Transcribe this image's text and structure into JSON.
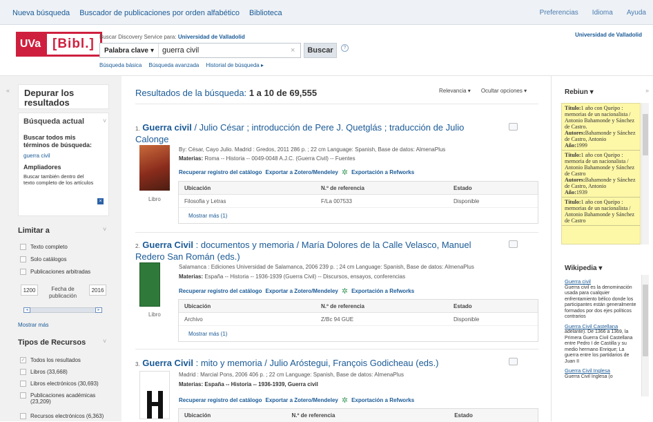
{
  "topbar": {
    "left": [
      "Nueva búsqueda",
      "Buscador de publicaciones por orden alfabético",
      "Biblioteca"
    ],
    "right": [
      "Preferencias",
      "Idioma",
      "Ayuda"
    ]
  },
  "header": {
    "logo_uva": "UVa",
    "logo_bibl": "[Bibl.]",
    "service_prefix": "Buscar Discovery Service para:",
    "service_org": "Universidad de Valladolid",
    "search_type": "Palabra clave",
    "search_value": "guerra civil",
    "search_button": "Buscar",
    "help": "?",
    "links": [
      "Búsqueda básica",
      "Búsqueda avanzada",
      "Historial de búsqueda ▸"
    ],
    "institution": "Universidad de Valladolid"
  },
  "left": {
    "refine_title": "Depurar los resultados",
    "current_search": "Búsqueda actual",
    "search_all": "Buscar todos mis términos de búsqueda:",
    "term": "guerra civil",
    "expanders": "Ampliadores",
    "expander_opt": "Buscar también dentro del texto completo de los artículos",
    "limit_to": "Limitar a",
    "limits": [
      "Texto completo",
      "Solo catálogos",
      "Publicaciones arbitradas"
    ],
    "date_from": "1200",
    "date_label": "Fecha de publicación",
    "date_to": "2016",
    "show_more": "Mostrar más",
    "resource_types": "Tipos de Recursos",
    "types": [
      "Todos los resultados",
      "Libros (33,668)",
      "Libros electrónicos (30,693)",
      "Publicaciones académicas (23,209)",
      "Recursos electrónicos (6,363)"
    ]
  },
  "main": {
    "results_label": "Resultados de la búsqueda:",
    "results_count": "1 a 10 de 69,555",
    "sort": "Relevancia ▾",
    "options": "Ocultar opciones ▾",
    "records": [
      {
        "num": "1.",
        "title_bold": "Guerra civil",
        "title_rest": " / Julio César ; introducción de Pere J. Quetglás ; traducción de Julio Calonge",
        "byline": "By: César, Cayo Julio. Madrid : Gredos, 2011 286 p. ; 22 cm Language: Spanish, Base de datos: AlmenaPlus",
        "subjects_label": "Materias:",
        "subjects": " Roma -- Historia -- 0049-0048 A.J.C. (Guerra Civil) -- Fuentes",
        "type": "Libro",
        "rows": [
          [
            "Filosofia y Letras",
            "F/La 007533",
            "Disponible"
          ]
        ]
      },
      {
        "num": "2.",
        "title_bold": "Guerra Civil",
        "title_rest": " : documentos y memoria / María Dolores de la Calle Velasco, Manuel Redero San Román (eds.)",
        "byline": "Salamanca : Ediciones Universidad de Salamanca, 2006 239 p. ; 24 cm Language: Spanish, Base de datos: AlmenaPlus",
        "subjects_label": "Materias:",
        "subjects": " España -- Historia -- 1936-1939 (Guerra Civil) -- Discursos, ensayos, conferencias",
        "type": "Libro",
        "rows": [
          [
            "Archivo",
            "Z/Bc 94 GUE",
            "Disponible"
          ]
        ]
      },
      {
        "num": "3.",
        "title_bold": "Guerra Civil",
        "title_rest": " : mito y memoria / Julio Aróstegui, François Godicheau (eds.)",
        "byline": "Madrid : Marcial Pons, 2006 406 p. ; 22 cm Language: Spanish, Base de datos: AlmenaPlus",
        "subjects_label": "Materias:",
        "subjects": " España -- Historia -- 1936-1939, Guerra civil",
        "type": "",
        "rows": []
      }
    ],
    "actions": [
      "Recuperar registro del catálogo",
      "Exportar a Zotero/Mendeley",
      "Exportación a Refworks"
    ],
    "table_headers": [
      "Ubicación",
      "N.º de referencia",
      "Estado"
    ],
    "show_more": "Mostrar más (1)"
  },
  "right": {
    "rebiun_title": "Rebiun",
    "rebiun_items": [
      {
        "t": "Título:",
        "tv": "1 año con Queipo : memorias de un nacionalista / Antonio Bahamonde y Sánchez de Castro.",
        "a": "Autores:",
        "av": "Bahamonde y Sánchez de Castro, Antonio",
        "y": "Año:",
        "yv": "1999"
      },
      {
        "t": "Título:",
        "tv": "1 año con Queipo : memoria de un nacionalista / Antonio Bahamonde y Sánchez de Castro",
        "a": "Autores:",
        "av": "Bahamonde y Sánchez de Castro, Antonio",
        "y": "Año:",
        "yv": "1939"
      },
      {
        "t": "Título:",
        "tv": "1 año con Queipo : memorias de un nacionalista / Antonio Bahamonde y Sánchez de Castro",
        "a": "",
        "av": "",
        "y": "",
        "yv": ""
      }
    ],
    "wiki_title": "Wikipedia",
    "wiki": [
      {
        "link": "Guerra civil",
        "text": "Guerra civil es la denominación usada para cualquier enfrentamiento bélico donde los participantes están generalmente formados por dos ejes políticos contrarios"
      },
      {
        "link": "Guerra Civil Castellana",
        "text": "adelante). De 1366 a 1369, la Primera Guerra Civil Castellana entre Pedro I de Castilla y su medio hermano Enrique; La guerra entre los partidarios de Juan II"
      },
      {
        "link": "Guerra Civil Inglesa",
        "text": "Guerra Civil Inglesa (o"
      }
    ]
  },
  "colors": {
    "accent": "#1a5a96",
    "brand": "#cf1f3e",
    "rebiun_bg": "#fdf7a8"
  }
}
